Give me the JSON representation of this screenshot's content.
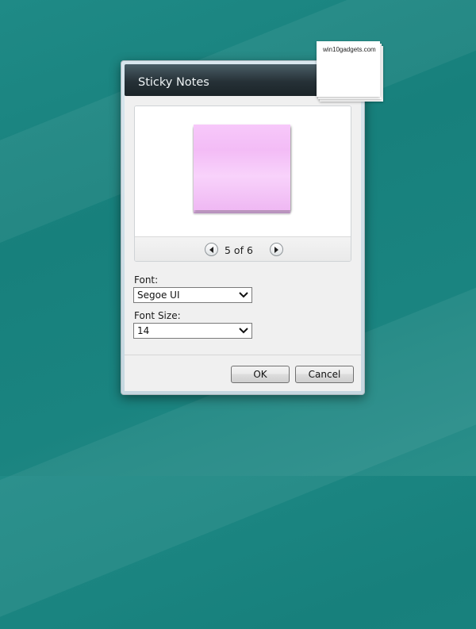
{
  "dialog": {
    "title": "Sticky Notes",
    "pager": {
      "text": "5 of 6",
      "current": 5,
      "total": 6
    },
    "font": {
      "label": "Font:",
      "value": "Segoe UI"
    },
    "font_size": {
      "label": "Font Size:",
      "value": "14"
    },
    "ok_label": "OK",
    "cancel_label": "Cancel"
  },
  "watermark": {
    "text": "win10gadgets.com"
  },
  "colors": {
    "desktop": "#1f8a86",
    "note": "#f5c4f8",
    "titlebar": "#263137"
  },
  "icons": {
    "prev": "arrow-left-icon",
    "next": "arrow-right-icon",
    "dropdown": "chevron-down-icon"
  }
}
